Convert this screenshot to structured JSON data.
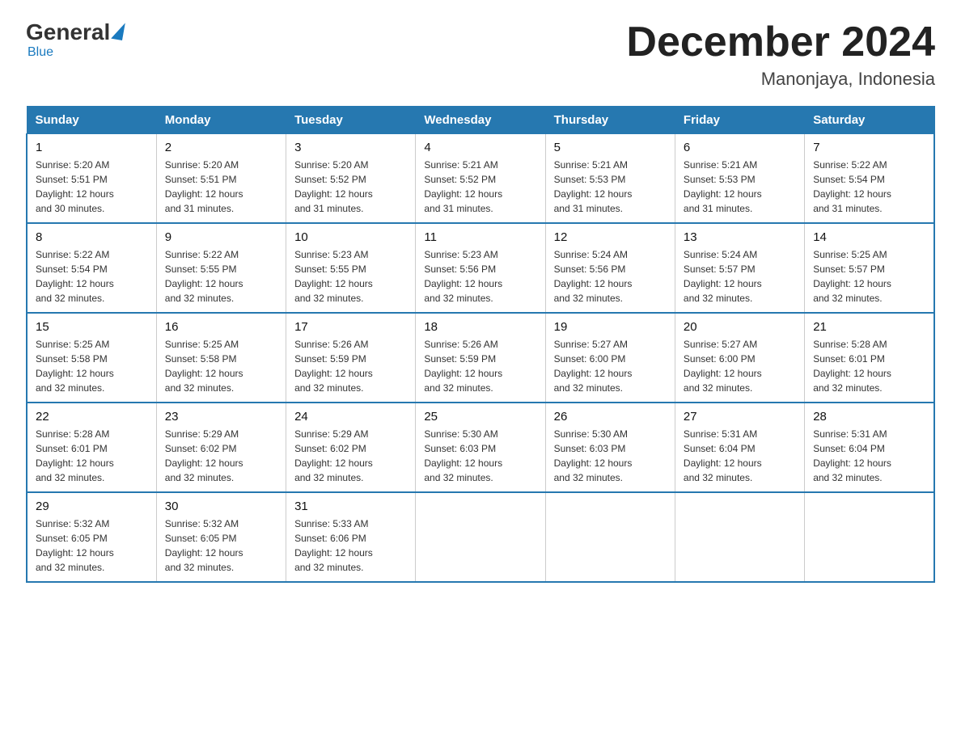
{
  "header": {
    "logo": {
      "general": "General",
      "blue": "Blue"
    },
    "title": "December 2024",
    "location": "Manonjaya, Indonesia"
  },
  "weekdays": [
    "Sunday",
    "Monday",
    "Tuesday",
    "Wednesday",
    "Thursday",
    "Friday",
    "Saturday"
  ],
  "weeks": [
    [
      {
        "day": "1",
        "sunrise": "5:20 AM",
        "sunset": "5:51 PM",
        "daylight": "12 hours and 30 minutes."
      },
      {
        "day": "2",
        "sunrise": "5:20 AM",
        "sunset": "5:51 PM",
        "daylight": "12 hours and 31 minutes."
      },
      {
        "day": "3",
        "sunrise": "5:20 AM",
        "sunset": "5:52 PM",
        "daylight": "12 hours and 31 minutes."
      },
      {
        "day": "4",
        "sunrise": "5:21 AM",
        "sunset": "5:52 PM",
        "daylight": "12 hours and 31 minutes."
      },
      {
        "day": "5",
        "sunrise": "5:21 AM",
        "sunset": "5:53 PM",
        "daylight": "12 hours and 31 minutes."
      },
      {
        "day": "6",
        "sunrise": "5:21 AM",
        "sunset": "5:53 PM",
        "daylight": "12 hours and 31 minutes."
      },
      {
        "day": "7",
        "sunrise": "5:22 AM",
        "sunset": "5:54 PM",
        "daylight": "12 hours and 31 minutes."
      }
    ],
    [
      {
        "day": "8",
        "sunrise": "5:22 AM",
        "sunset": "5:54 PM",
        "daylight": "12 hours and 32 minutes."
      },
      {
        "day": "9",
        "sunrise": "5:22 AM",
        "sunset": "5:55 PM",
        "daylight": "12 hours and 32 minutes."
      },
      {
        "day": "10",
        "sunrise": "5:23 AM",
        "sunset": "5:55 PM",
        "daylight": "12 hours and 32 minutes."
      },
      {
        "day": "11",
        "sunrise": "5:23 AM",
        "sunset": "5:56 PM",
        "daylight": "12 hours and 32 minutes."
      },
      {
        "day": "12",
        "sunrise": "5:24 AM",
        "sunset": "5:56 PM",
        "daylight": "12 hours and 32 minutes."
      },
      {
        "day": "13",
        "sunrise": "5:24 AM",
        "sunset": "5:57 PM",
        "daylight": "12 hours and 32 minutes."
      },
      {
        "day": "14",
        "sunrise": "5:25 AM",
        "sunset": "5:57 PM",
        "daylight": "12 hours and 32 minutes."
      }
    ],
    [
      {
        "day": "15",
        "sunrise": "5:25 AM",
        "sunset": "5:58 PM",
        "daylight": "12 hours and 32 minutes."
      },
      {
        "day": "16",
        "sunrise": "5:25 AM",
        "sunset": "5:58 PM",
        "daylight": "12 hours and 32 minutes."
      },
      {
        "day": "17",
        "sunrise": "5:26 AM",
        "sunset": "5:59 PM",
        "daylight": "12 hours and 32 minutes."
      },
      {
        "day": "18",
        "sunrise": "5:26 AM",
        "sunset": "5:59 PM",
        "daylight": "12 hours and 32 minutes."
      },
      {
        "day": "19",
        "sunrise": "5:27 AM",
        "sunset": "6:00 PM",
        "daylight": "12 hours and 32 minutes."
      },
      {
        "day": "20",
        "sunrise": "5:27 AM",
        "sunset": "6:00 PM",
        "daylight": "12 hours and 32 minutes."
      },
      {
        "day": "21",
        "sunrise": "5:28 AM",
        "sunset": "6:01 PM",
        "daylight": "12 hours and 32 minutes."
      }
    ],
    [
      {
        "day": "22",
        "sunrise": "5:28 AM",
        "sunset": "6:01 PM",
        "daylight": "12 hours and 32 minutes."
      },
      {
        "day": "23",
        "sunrise": "5:29 AM",
        "sunset": "6:02 PM",
        "daylight": "12 hours and 32 minutes."
      },
      {
        "day": "24",
        "sunrise": "5:29 AM",
        "sunset": "6:02 PM",
        "daylight": "12 hours and 32 minutes."
      },
      {
        "day": "25",
        "sunrise": "5:30 AM",
        "sunset": "6:03 PM",
        "daylight": "12 hours and 32 minutes."
      },
      {
        "day": "26",
        "sunrise": "5:30 AM",
        "sunset": "6:03 PM",
        "daylight": "12 hours and 32 minutes."
      },
      {
        "day": "27",
        "sunrise": "5:31 AM",
        "sunset": "6:04 PM",
        "daylight": "12 hours and 32 minutes."
      },
      {
        "day": "28",
        "sunrise": "5:31 AM",
        "sunset": "6:04 PM",
        "daylight": "12 hours and 32 minutes."
      }
    ],
    [
      {
        "day": "29",
        "sunrise": "5:32 AM",
        "sunset": "6:05 PM",
        "daylight": "12 hours and 32 minutes."
      },
      {
        "day": "30",
        "sunrise": "5:32 AM",
        "sunset": "6:05 PM",
        "daylight": "12 hours and 32 minutes."
      },
      {
        "day": "31",
        "sunrise": "5:33 AM",
        "sunset": "6:06 PM",
        "daylight": "12 hours and 32 minutes."
      },
      null,
      null,
      null,
      null
    ]
  ],
  "labels": {
    "sunrise": "Sunrise:",
    "sunset": "Sunset:",
    "daylight": "Daylight:"
  }
}
